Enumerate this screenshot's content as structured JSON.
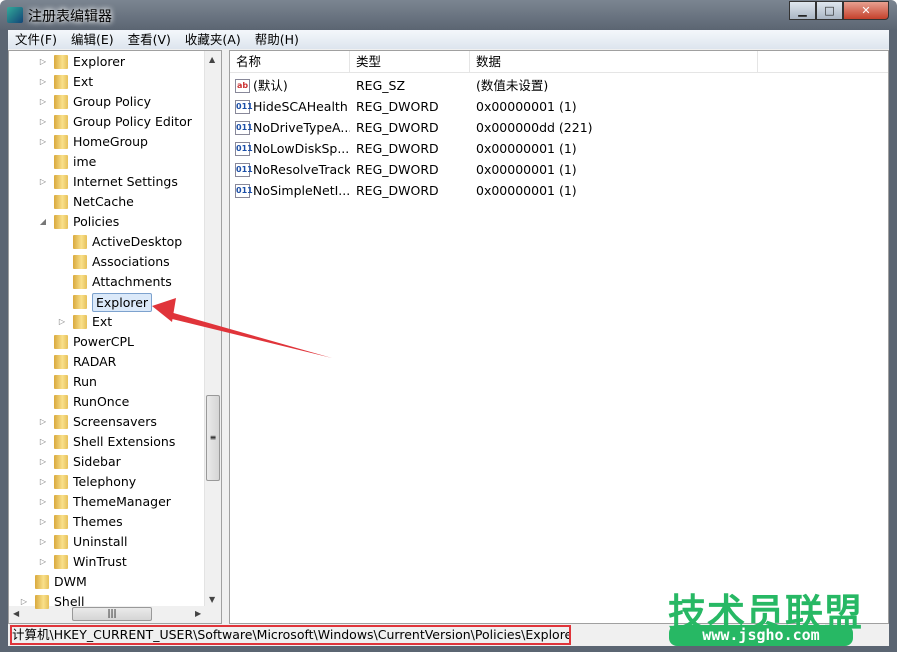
{
  "window": {
    "title": "注册表编辑器",
    "min": "▁",
    "max": "□",
    "close": "✕"
  },
  "menu": [
    "文件(F)",
    "编辑(E)",
    "查看(V)",
    "收藏夹(A)",
    "帮助(H)"
  ],
  "tree": [
    {
      "label": "Explorer",
      "level": 1,
      "expander": "▷"
    },
    {
      "label": "Ext",
      "level": 1,
      "expander": "▷"
    },
    {
      "label": "Group Policy",
      "level": 1,
      "expander": "▷"
    },
    {
      "label": "Group Policy Editor",
      "level": 1,
      "expander": "▷"
    },
    {
      "label": "HomeGroup",
      "level": 1,
      "expander": "▷"
    },
    {
      "label": "ime",
      "level": 1,
      "expander": ""
    },
    {
      "label": "Internet Settings",
      "level": 1,
      "expander": "▷"
    },
    {
      "label": "NetCache",
      "level": 1,
      "expander": ""
    },
    {
      "label": "Policies",
      "level": 1,
      "expander": "◢"
    },
    {
      "label": "ActiveDesktop",
      "level": 2,
      "expander": ""
    },
    {
      "label": "Associations",
      "level": 2,
      "expander": ""
    },
    {
      "label": "Attachments",
      "level": 2,
      "expander": ""
    },
    {
      "label": "Explorer",
      "level": 2,
      "expander": "",
      "selected": true
    },
    {
      "label": "Ext",
      "level": 2,
      "expander": "▷"
    },
    {
      "label": "PowerCPL",
      "level": 1,
      "expander": ""
    },
    {
      "label": "RADAR",
      "level": 1,
      "expander": ""
    },
    {
      "label": "Run",
      "level": 1,
      "expander": ""
    },
    {
      "label": "RunOnce",
      "level": 1,
      "expander": ""
    },
    {
      "label": "Screensavers",
      "level": 1,
      "expander": "▷"
    },
    {
      "label": "Shell Extensions",
      "level": 1,
      "expander": "▷"
    },
    {
      "label": "Sidebar",
      "level": 1,
      "expander": "▷"
    },
    {
      "label": "Telephony",
      "level": 1,
      "expander": "▷"
    },
    {
      "label": "ThemeManager",
      "level": 1,
      "expander": "▷"
    },
    {
      "label": "Themes",
      "level": 1,
      "expander": "▷"
    },
    {
      "label": "Uninstall",
      "level": 1,
      "expander": "▷"
    },
    {
      "label": "WinTrust",
      "level": 1,
      "expander": "▷"
    },
    {
      "label": "DWM",
      "level": 0,
      "expander": ""
    },
    {
      "label": "Shell",
      "level": 0,
      "expander": "▷"
    }
  ],
  "list": {
    "columns": [
      "名称",
      "类型",
      "数据"
    ],
    "rows": [
      {
        "icon": "string-value-icon",
        "glyph": "ab",
        "name": "(默认)",
        "type": "REG_SZ",
        "data": "(数值未设置)"
      },
      {
        "icon": "dword-value-icon",
        "glyph": "011",
        "name": "HideSCAHealth",
        "type": "REG_DWORD",
        "data": "0x00000001 (1)"
      },
      {
        "icon": "dword-value-icon",
        "glyph": "011",
        "name": "NoDriveTypeA...",
        "type": "REG_DWORD",
        "data": "0x000000dd (221)"
      },
      {
        "icon": "dword-value-icon",
        "glyph": "011",
        "name": "NoLowDiskSp...",
        "type": "REG_DWORD",
        "data": "0x00000001 (1)"
      },
      {
        "icon": "dword-value-icon",
        "glyph": "011",
        "name": "NoResolveTrack",
        "type": "REG_DWORD",
        "data": "0x00000001 (1)"
      },
      {
        "icon": "dword-value-icon",
        "glyph": "011",
        "name": "NoSimpleNetI...",
        "type": "REG_DWORD",
        "data": "0x00000001 (1)"
      }
    ]
  },
  "status": {
    "path": "计算机\\HKEY_CURRENT_USER\\Software\\Microsoft\\Windows\\CurrentVersion\\Policies\\Explorer"
  },
  "watermark": {
    "name": "技术员联盟",
    "url": "www.jsgho.com"
  },
  "colors": {
    "highlight": "#e0343a",
    "watermark": "#27b864"
  }
}
